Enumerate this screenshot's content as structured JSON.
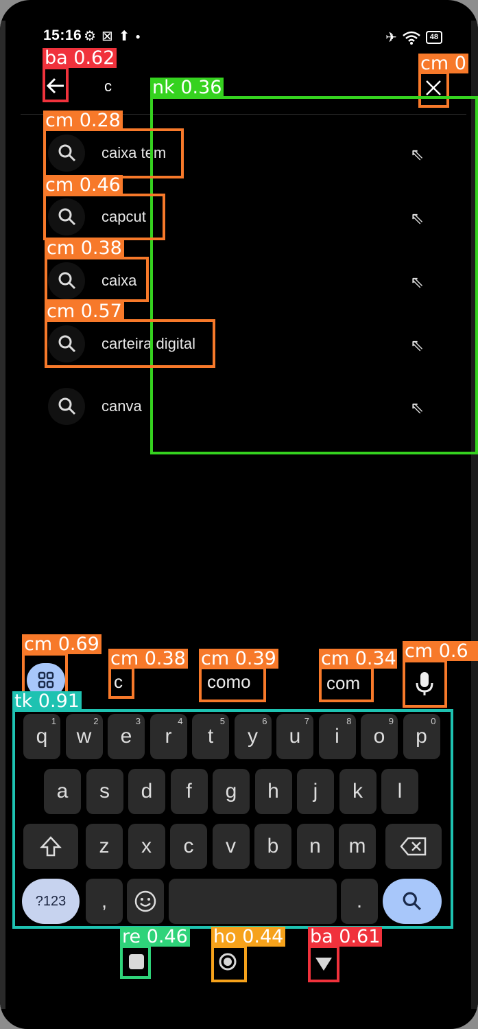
{
  "status": {
    "time": "15:16",
    "battery": "48"
  },
  "search": {
    "query": "c"
  },
  "suggestions": [
    {
      "label": "caixa tem"
    },
    {
      "label": "capcut"
    },
    {
      "label": "caixa"
    },
    {
      "label": "carteira digital"
    },
    {
      "label": "canva"
    }
  ],
  "keyboard": {
    "suggestions": [
      "c",
      "como",
      "com"
    ],
    "row1": [
      "q",
      "w",
      "e",
      "r",
      "t",
      "y",
      "u",
      "i",
      "o",
      "p"
    ],
    "row1_hints": [
      "1",
      "2",
      "3",
      "4",
      "5",
      "6",
      "7",
      "8",
      "9",
      "0"
    ],
    "row2": [
      "a",
      "s",
      "d",
      "f",
      "g",
      "h",
      "j",
      "k",
      "l"
    ],
    "row3": [
      "z",
      "x",
      "c",
      "v",
      "b",
      "n",
      "m"
    ],
    "symbols_label": "?123",
    "comma": ",",
    "period": "."
  },
  "detections": [
    {
      "label": "ba 0.62"
    },
    {
      "label": "cm 0"
    },
    {
      "label": "nk 0.36"
    },
    {
      "label": "cm 0.28"
    },
    {
      "label": "cm 0.46"
    },
    {
      "label": "cm 0.38"
    },
    {
      "label": "cm 0.57"
    },
    {
      "label": "cm 0.69"
    },
    {
      "label": "cm 0.38"
    },
    {
      "label": "cm 0.39"
    },
    {
      "label": "cm 0.34"
    },
    {
      "label": "cm 0.6"
    },
    {
      "label": "tk 0.91"
    },
    {
      "label": "re 0.46"
    },
    {
      "label": "ho 0.44"
    },
    {
      "label": "ba 0.61"
    }
  ],
  "colors": {
    "background": "#000000",
    "key": "#2b2b2b",
    "accent": "#a8c7fa"
  },
  "icons": [
    "back-arrow-icon",
    "close-icon",
    "search-icon",
    "fill-arrow-icon",
    "apps-grid-icon",
    "mic-icon",
    "shift-icon",
    "backspace-icon",
    "emoji-icon",
    "recent-apps-icon",
    "home-icon",
    "back-triangle-icon"
  ]
}
